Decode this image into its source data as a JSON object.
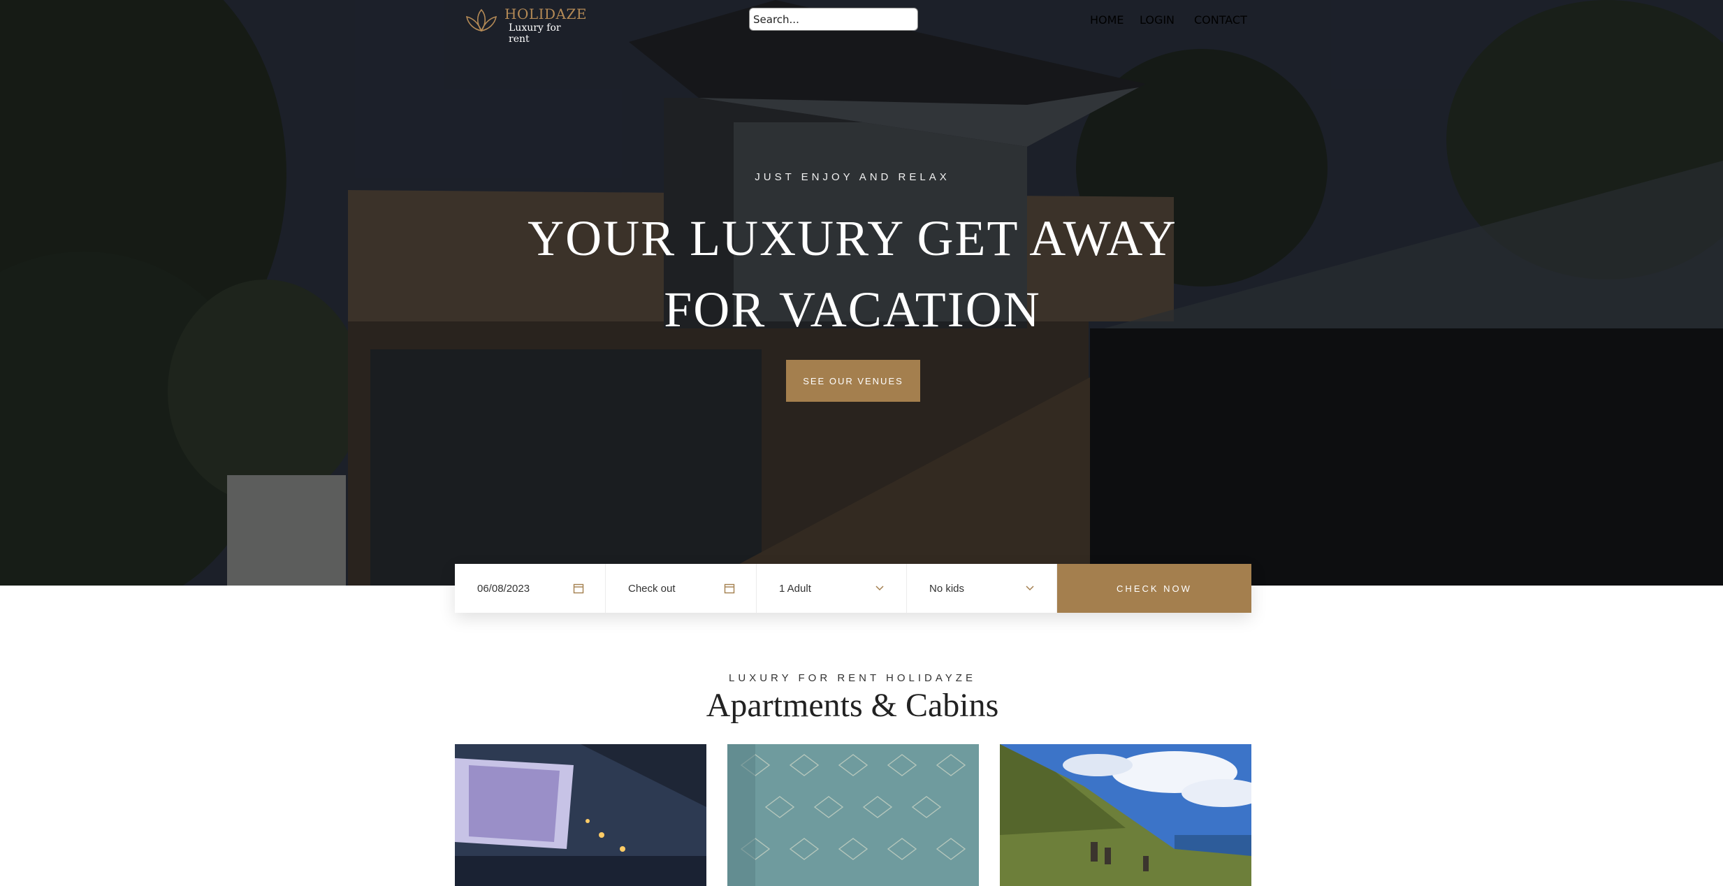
{
  "brand": {
    "name": "HOLIDAZE",
    "subtitle": "Luxury for rent"
  },
  "search": {
    "placeholder": "Search..."
  },
  "nav": {
    "items": [
      "HOME",
      "LOGIN",
      "CONTACT"
    ]
  },
  "hero": {
    "tagline": "JUST ENJOY AND RELAX",
    "title_line1": "YOUR LUXURY GET AWAY",
    "title_line2": "FOR VACATION",
    "cta_label": "SEE OUR VENUES"
  },
  "booking": {
    "check_in_value": "06/08/2023",
    "check_out_placeholder": "Check out",
    "adults_selected": "1 Adult",
    "kids_selected": "No kids",
    "submit_label": "CHECK NOW"
  },
  "section": {
    "eyebrow": "LUXURY FOR RENT HOLIDAYZE",
    "title": "Apartments & Cabins"
  },
  "colors": {
    "accent": "#a47f4e",
    "logo_gold": "#b48a56",
    "hero_dark": "#1c1b1a"
  },
  "icons": [
    "lotus-logo-icon",
    "calendar-icon",
    "chevron-down-icon"
  ]
}
